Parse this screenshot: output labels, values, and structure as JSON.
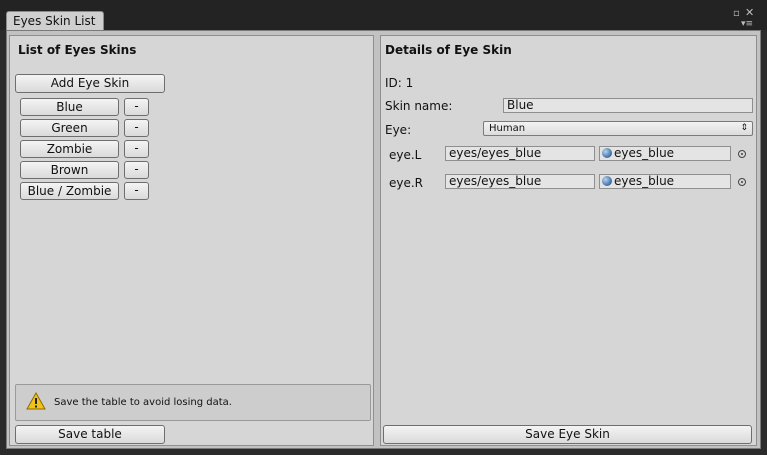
{
  "window": {
    "tab_title": "Eyes Skin List",
    "maximize_glyph": "▫",
    "close_glyph": "✕",
    "menu_glyph": "▾≡"
  },
  "left_panel": {
    "title": "List of Eyes Skins",
    "add_button": "Add Eye Skin",
    "remove_label": "-",
    "skins": [
      "Blue",
      "Green",
      "Zombie",
      "Brown",
      "Blue / Zombie"
    ],
    "help_text": "Save the table to avoid losing data.",
    "help_icon": "warning-icon",
    "save_button": "Save table"
  },
  "right_panel": {
    "title": "Details of Eye Skin",
    "id_text": "ID: 1",
    "skin_name_label": "Skin name:",
    "skin_name_value": "Blue",
    "eye_label": "Eye:",
    "eye_value": "Human",
    "dropdown_arrow": "⇕",
    "rows": [
      {
        "label": "eye.L",
        "path": "eyes/eyes_blue",
        "object": "eyes_blue"
      },
      {
        "label": "eye.R",
        "path": "eyes/eyes_blue",
        "object": "eyes_blue"
      }
    ],
    "save_button": "Save Eye Skin"
  },
  "colors": {
    "panel_bg": "#d6d6d6",
    "window_bg": "#c2c2c2",
    "chrome_bg": "#232323",
    "warning_yellow": "#f2c21c"
  }
}
